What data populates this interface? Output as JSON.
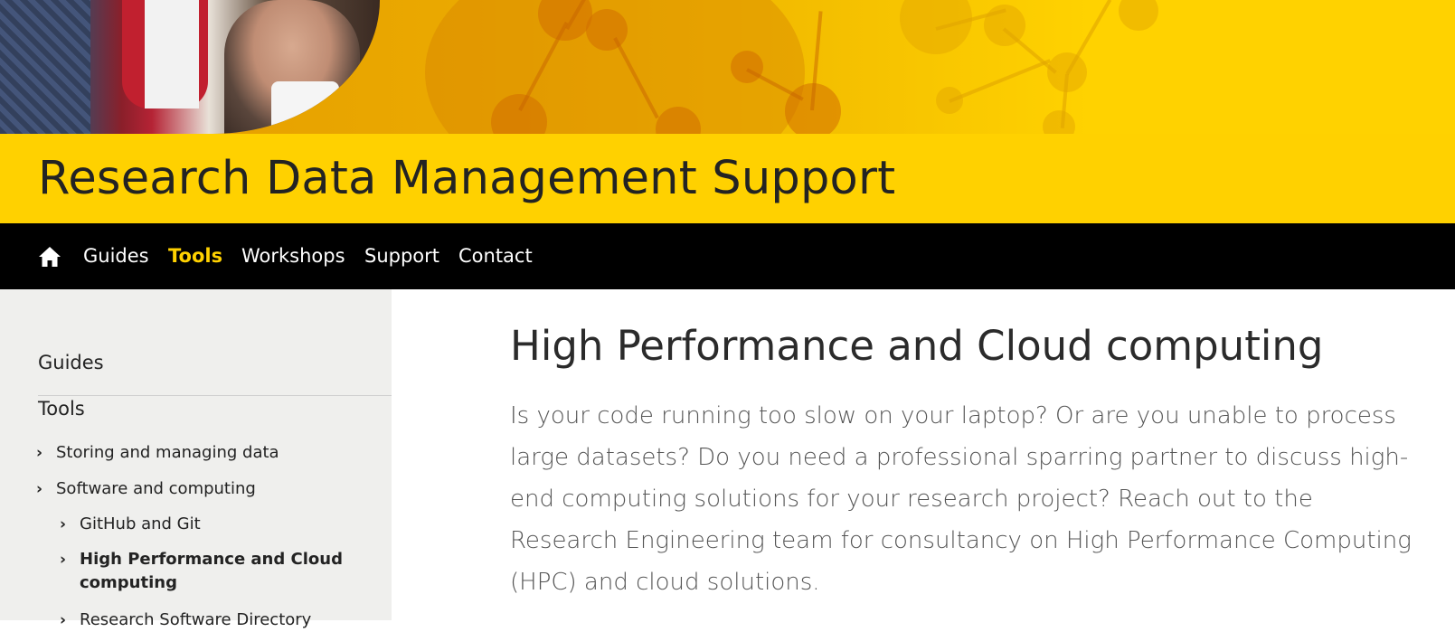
{
  "site": {
    "title": "Research Data Management Support"
  },
  "nav": {
    "home_icon": "home-icon",
    "items": [
      {
        "label": "Guides",
        "active": false
      },
      {
        "label": "Tools",
        "active": true
      },
      {
        "label": "Workshops",
        "active": false
      },
      {
        "label": "Support",
        "active": false
      },
      {
        "label": "Contact",
        "active": false
      }
    ]
  },
  "sidebar": {
    "sections": [
      {
        "label": "Guides"
      },
      {
        "label": "Tools"
      }
    ],
    "items": [
      {
        "label": "Storing and managing data",
        "level": 1
      },
      {
        "label": "Software and computing",
        "level": 1
      },
      {
        "label": "GitHub and Git",
        "level": 2
      },
      {
        "label": "High Performance and Cloud computing",
        "level": 2,
        "current": true
      },
      {
        "label": "Research Software Directory",
        "level": 2
      }
    ]
  },
  "main": {
    "heading": "High Performance and Cloud computing",
    "intro": "Is your code running too slow on your laptop? Or are you unable to process large datasets? Do you need a professional sparring partner to discuss high-end computing solutions for your research project? Reach out to the Research Engineering team for consultancy on High Performance Computing (HPC) and cloud solutions."
  },
  "colors": {
    "brand_yellow": "#ffd100",
    "nav_bg": "#000000",
    "sidebar_bg": "#efefed"
  }
}
